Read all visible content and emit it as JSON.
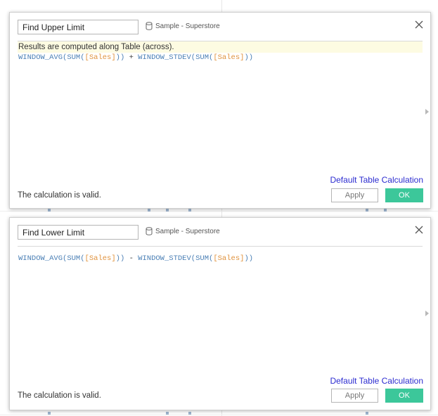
{
  "colors": {
    "function": "#4a7fb5",
    "field": "#e0923d",
    "link": "#2b2bd0",
    "ok_button": "#3cc79a",
    "info_bar": "#fdfbe2"
  },
  "dialogs": [
    {
      "calc_name": "Find Upper Limit",
      "data_source": "Sample - Superstore",
      "info_message": "Results are computed along Table (across).",
      "formula": {
        "fn1": "WINDOW_AVG",
        "p1": "(",
        "fn2": "SUM",
        "p2": "(",
        "field1": "[Sales]",
        "p3": "))",
        "operator": " + ",
        "fn3": "WINDOW_STDEV",
        "p4": "(",
        "fn4": "SUM",
        "p5": "(",
        "field2": "[Sales]",
        "p6": "))"
      },
      "default_link": "Default Table Calculation",
      "status": "The calculation is valid.",
      "apply_label": "Apply",
      "ok_label": "OK"
    },
    {
      "calc_name": "Find Lower Limit",
      "data_source": "Sample - Superstore",
      "formula": {
        "fn1": "WINDOW_AVG",
        "p1": "(",
        "fn2": "SUM",
        "p2": "(",
        "field1": "[Sales]",
        "p3": "))",
        "operator": " - ",
        "fn3": "WINDOW_STDEV",
        "p4": "(",
        "fn4": "SUM",
        "p5": "(",
        "field2": "[Sales]",
        "p6": "))"
      },
      "default_link": "Default Table Calculation",
      "status": "The calculation is valid.",
      "apply_label": "Apply",
      "ok_label": "OK"
    }
  ]
}
